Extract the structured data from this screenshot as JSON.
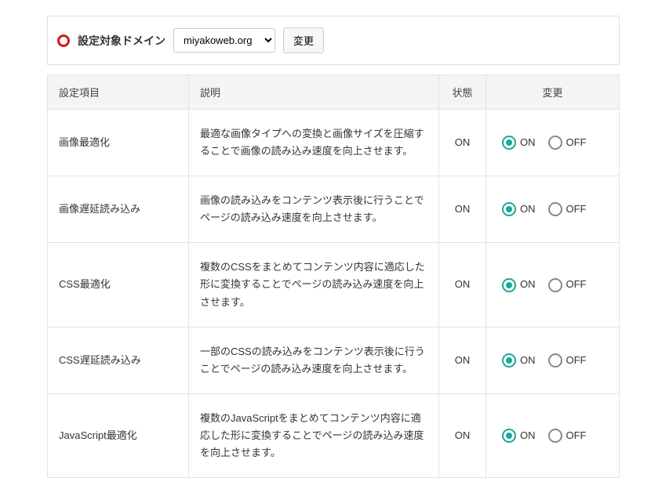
{
  "domain_bar": {
    "label": "設定対象ドメイン",
    "selected": "miyakoweb.org",
    "change_button": "変更"
  },
  "table": {
    "headers": {
      "item": "設定項目",
      "description": "説明",
      "status": "状態",
      "change": "変更"
    },
    "radio_on": "ON",
    "radio_off": "OFF",
    "rows": [
      {
        "item": "画像最適化",
        "description": "最適な画像タイプへの変換と画像サイズを圧縮することで画像の読み込み速度を向上させます。",
        "status": "ON",
        "selected": "ON"
      },
      {
        "item": "画像遅延読み込み",
        "description": "画像の読み込みをコンテンツ表示後に行うことでページの読み込み速度を向上させます。",
        "status": "ON",
        "selected": "ON"
      },
      {
        "item": "CSS最適化",
        "description": "複数のCSSをまとめてコンテンツ内容に適応した形に変換することでページの読み込み速度を向上させます。",
        "status": "ON",
        "selected": "ON"
      },
      {
        "item": "CSS遅延読み込み",
        "description": "一部のCSSの読み込みをコンテンツ表示後に行うことでページの読み込み速度を向上させます。",
        "status": "ON",
        "selected": "ON"
      },
      {
        "item": "JavaScript最適化",
        "description": "複数のJavaScriptをまとめてコンテンツ内容に適応した形に変換することでページの読み込み速度を向上させます。",
        "status": "ON",
        "selected": "ON"
      }
    ]
  }
}
